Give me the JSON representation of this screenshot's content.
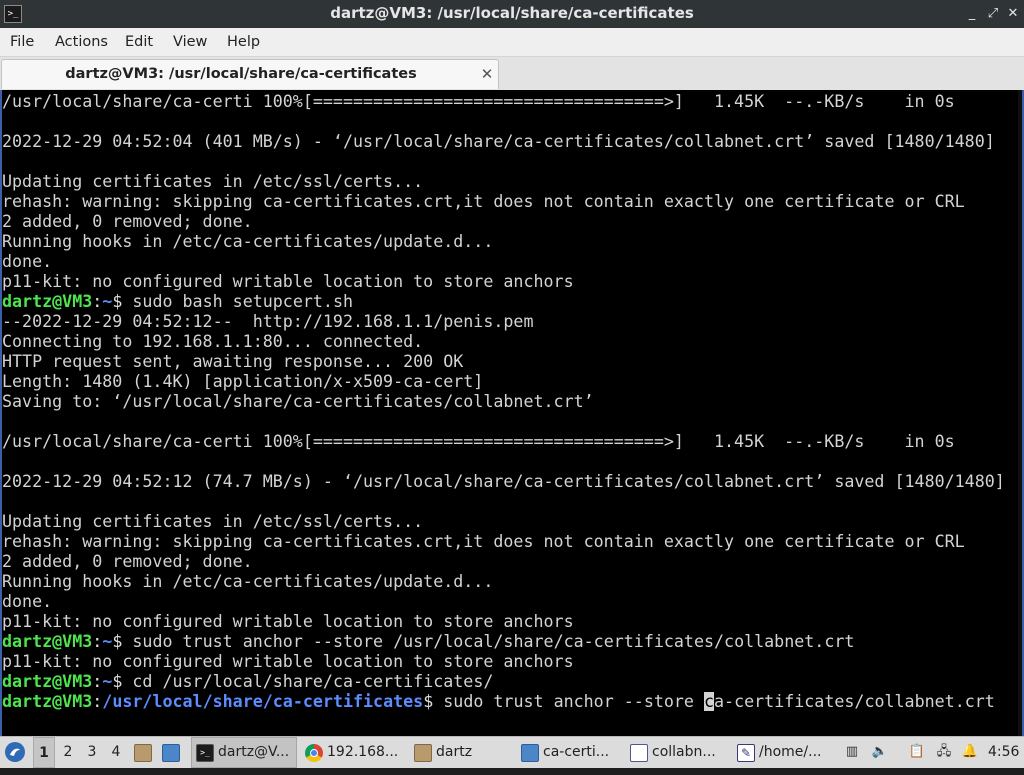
{
  "window": {
    "title": "dartz@VM3: /usr/local/share/ca-certificates",
    "app_icon": "terminal-icon",
    "app_icon_glyph": ">_",
    "controls": {
      "minimize": "_",
      "maximize": "⤢",
      "close": "✕"
    }
  },
  "menubar": {
    "items": [
      {
        "label": "File"
      },
      {
        "label": "Actions"
      },
      {
        "label": "Edit"
      },
      {
        "label": "View"
      },
      {
        "label": "Help"
      }
    ]
  },
  "tab": {
    "label": "dartz@VM3: /usr/local/share/ca-certificates",
    "close": "✕"
  },
  "terminal": {
    "colors": {
      "text": "#d3d3d3",
      "user": "#4ee44e",
      "path": "#5c8cff",
      "background": "#000000"
    },
    "output1": [
      "/usr/local/share/ca-certi 100%[===================================>]   1.45K  --.-KB/s    in 0s",
      "",
      "2022-12-29 04:52:04 (401 MB/s) - ‘/usr/local/share/ca-certificates/collabnet.crt’ saved [1480/1480]",
      "",
      "Updating certificates in /etc/ssl/certs...",
      "rehash: warning: skipping ca-certificates.crt,it does not contain exactly one certificate or CRL",
      "2 added, 0 removed; done.",
      "Running hooks in /etc/ca-certificates/update.d...",
      "done.",
      "p11-kit: no configured writable location to store anchors"
    ],
    "prompt1": {
      "user": "dartz@VM3",
      "sep": ":",
      "path": "~",
      "sym": "$ ",
      "cmd": "sudo bash setupcert.sh"
    },
    "output2": [
      "--2022-12-29 04:52:12--  http://192.168.1.1/penis.pem",
      "Connecting to 192.168.1.1:80... connected.",
      "HTTP request sent, awaiting response... 200 OK",
      "Length: 1480 (1.4K) [application/x-x509-ca-cert]",
      "Saving to: ‘/usr/local/share/ca-certificates/collabnet.crt’",
      "",
      "/usr/local/share/ca-certi 100%[===================================>]   1.45K  --.-KB/s    in 0s",
      "",
      "2022-12-29 04:52:12 (74.7 MB/s) - ‘/usr/local/share/ca-certificates/collabnet.crt’ saved [1480/1480]",
      "",
      "Updating certificates in /etc/ssl/certs...",
      "rehash: warning: skipping ca-certificates.crt,it does not contain exactly one certificate or CRL",
      "2 added, 0 removed; done.",
      "Running hooks in /etc/ca-certificates/update.d...",
      "done.",
      "p11-kit: no configured writable location to store anchors"
    ],
    "prompt2": {
      "user": "dartz@VM3",
      "sep": ":",
      "path": "~",
      "sym": "$ ",
      "cmd": "sudo trust anchor --store /usr/local/share/ca-certificates/collabnet.crt"
    },
    "output3": [
      "p11-kit: no configured writable location to store anchors"
    ],
    "prompt3": {
      "user": "dartz@VM3",
      "sep": ":",
      "path": "~",
      "sym": "$ ",
      "cmd": "cd /usr/local/share/ca-certificates/"
    },
    "prompt4": {
      "user": "dartz@VM3",
      "sep": ":",
      "path": "/usr/local/share/ca-certificates",
      "sym": "$ ",
      "cmd_before": "sudo trust anchor --store ",
      "cursor_char": "c",
      "cmd_after": "a-certificates/collabnet.crt"
    }
  },
  "taskbar": {
    "start_icon": "start-menu-icon",
    "workspaces": [
      "1",
      "2",
      "3",
      "4"
    ],
    "active_workspace": "1",
    "quick_launch": [
      "file-manager-icon",
      "show-desktop-icon"
    ],
    "tasks": [
      {
        "label": "dartz@V...",
        "icon": "terminal-icon",
        "active": true
      },
      {
        "label": "192.168...",
        "icon": "chrome-icon",
        "active": false
      },
      {
        "label": "dartz",
        "icon": "folder-icon",
        "active": false
      },
      {
        "label": "ca-certi...",
        "icon": "window-icon",
        "active": false
      },
      {
        "label": "collabn...",
        "icon": "document-icon",
        "active": false
      },
      {
        "label": "/home/...",
        "icon": "text-editor-icon",
        "active": false
      }
    ],
    "tray": [
      "trash-icon",
      "volume-icon",
      "clipboard-icon",
      "network-icon",
      "notification-icon",
      "monitor-icon"
    ],
    "clock": "4:56"
  }
}
